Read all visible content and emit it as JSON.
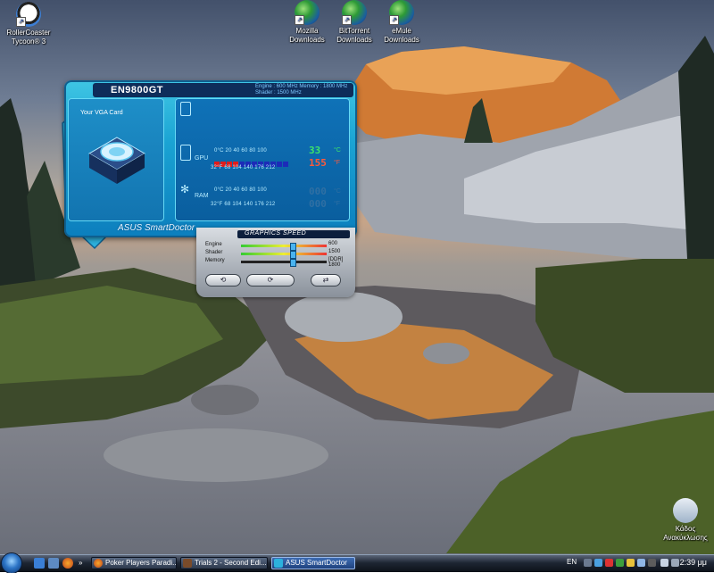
{
  "desktop": {
    "icons": [
      {
        "label_l1": "RollerCoaster",
        "label_l2": "Tycoon® 3"
      },
      {
        "label_l1": "Mozilla",
        "label_l2": "Downloads"
      },
      {
        "label_l1": "BitTorrent",
        "label_l2": "Downloads"
      },
      {
        "label_l1": "eMule",
        "label_l2": "Downloads"
      },
      {
        "label_l1": "Κάδος",
        "label_l2": "Ανακύκλωσης"
      }
    ]
  },
  "smartdoctor": {
    "title": "EN9800GT",
    "engine_line": "Engine : 600 MHz  Memory : 1800 MHz",
    "shader_line": "Shader : 1500 MHz",
    "vga_card_label": "Your VGA Card",
    "gpu_label": "GPU",
    "ram_label": "RAM",
    "scale_c": "0°C  20   40   60   80   100",
    "scale_f": "32°F  68  104  140  176  212",
    "gpu_temp_c": "33",
    "gpu_temp_f": "155",
    "ram_temp_c": "000",
    "ram_temp_f": "000",
    "unit_c": "°C",
    "unit_f": "°F",
    "gpu_bar_fill": 0.33,
    "brand": "ASUS SmartDoctor",
    "graphics_speed_label": "GRAPHICS SPEED",
    "sliders": [
      {
        "name": "Engine",
        "value": "600",
        "level": 0.6
      },
      {
        "name": "Shader",
        "value": "1500",
        "level": 0.6
      },
      {
        "name": "Memory",
        "value": "[DDR] 1800",
        "level": 0.6
      }
    ]
  },
  "taskbar": {
    "tasks": [
      {
        "label": "Poker Players Paradi...",
        "active": false
      },
      {
        "label": "Trials 2 - Second Edi...",
        "active": false
      },
      {
        "label": "ASUS SmartDoctor",
        "active": true
      }
    ],
    "language": "EN",
    "clock": "2:39 μμ"
  },
  "colors": {
    "temp_green": "#3ce36a",
    "temp_red": "#ff5a3a",
    "bar_red": "#e01c1c",
    "bar_blue": "#1c2bb8"
  }
}
